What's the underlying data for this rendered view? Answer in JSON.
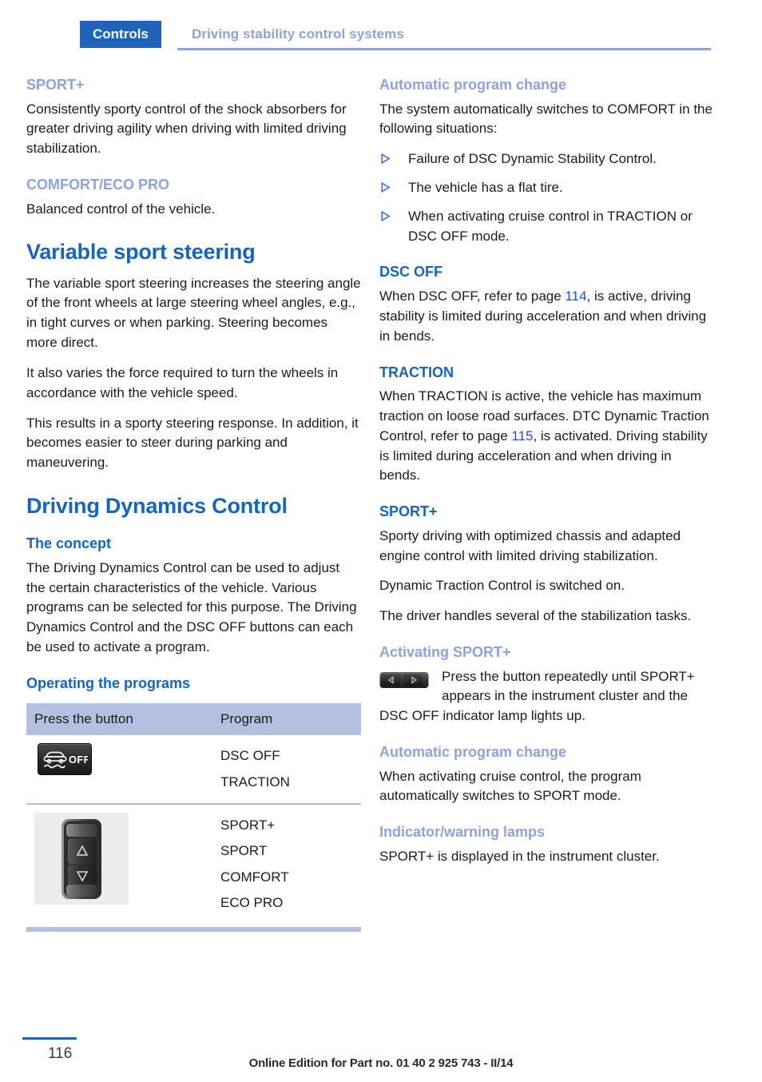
{
  "header": {
    "tab_label": "Controls",
    "title": "Driving stability control systems"
  },
  "left_column": {
    "sport_plus": {
      "heading": "SPORT+",
      "body": "Consistently sporty control of the shock absorbers for greater driving agility when driving with limited driving stabilization."
    },
    "comfort_eco": {
      "heading": "COMFORT/ECO PRO",
      "body": "Balanced control of the vehicle."
    },
    "variable_sport_steering": {
      "heading": "Variable sport steering",
      "p1": "The variable sport steering increases the steering angle of the front wheels at large steering wheel angles, e.g., in tight curves or when parking. Steering becomes more direct.",
      "p2": "It also varies the force required to turn the wheels in accordance with the vehicle speed.",
      "p3": "This results in a sporty steering response. In addition, it becomes easier to steer during parking and maneuvering."
    },
    "driving_dynamics_control": {
      "heading": "Driving Dynamics Control",
      "concept_heading": "The concept",
      "concept_body": "The Driving Dynamics Control can be used to adjust the certain characteristics of the vehicle. Various programs can be selected for this purpose. The Driving Dynamics Control and the DSC OFF buttons can each be used to activate a program.",
      "operating_heading": "Operating the programs"
    },
    "table": {
      "columns": [
        "Press the button",
        "Program"
      ],
      "rows": [
        {
          "icon": "dsc-off-button-icon",
          "icon_label": "OFF",
          "programs": [
            "DSC OFF",
            "TRACTION"
          ]
        },
        {
          "icon": "driving-dynamics-rocker-switch-icon",
          "programs": [
            "SPORT+",
            "SPORT",
            "COMFORT",
            "ECO PRO"
          ]
        }
      ]
    }
  },
  "right_column": {
    "auto_change_1": {
      "heading": "Automatic program change",
      "intro": "The system automatically switches to COMFORT in the following situations:",
      "bullets": [
        "Failure of DSC Dynamic Stability Control.",
        "The vehicle has a flat tire.",
        "When activating cruise control in TRACTION or DSC OFF mode."
      ]
    },
    "dsc_off": {
      "heading": "DSC OFF",
      "body_before": "When DSC OFF, refer to page ",
      "page_ref": "114",
      "body_after": ", is active, driving stability is limited during acceleration and when driving in bends."
    },
    "traction": {
      "heading": "TRACTION",
      "body_before": "When TRACTION is active, the vehicle has maximum traction on loose road surfaces. DTC Dynamic Traction Control, refer to page ",
      "page_ref": "115",
      "body_after": ", is activated. Driving stability is limited during acceleration and when driving in bends."
    },
    "sport_plus": {
      "heading": "SPORT+",
      "p1": "Sporty driving with optimized chassis and adapted engine control with limited driving stabilization.",
      "p2": "Dynamic Traction Control is switched on.",
      "p3": "The driver handles several of the stabilization tasks."
    },
    "activating_sport_plus": {
      "heading": "Activating SPORT+",
      "icon": "rocker-switch-inline-icon",
      "body": "Press the button repeatedly until SPORT+ appears in the instrument cluster and the DSC OFF indicator lamp lights up."
    },
    "auto_change_2": {
      "heading": "Automatic program change",
      "body": "When activating cruise control, the program automatically switches to SPORT mode."
    },
    "indicator_lamps": {
      "heading": "Indicator/warning lamps",
      "body": "SPORT+ is displayed in the instrument cluster."
    }
  },
  "footer": {
    "page_number": "116",
    "note": "Online Edition for Part no. 01 40 2 925 743 - II/14"
  },
  "colors": {
    "tab_blue": "#1f63ba",
    "heading_blue": "#1565c0",
    "heading_light_blue": "#8ca3dd",
    "table_header_bg": "#b3c0e0",
    "page_ref_blue": "#1a52d8"
  }
}
